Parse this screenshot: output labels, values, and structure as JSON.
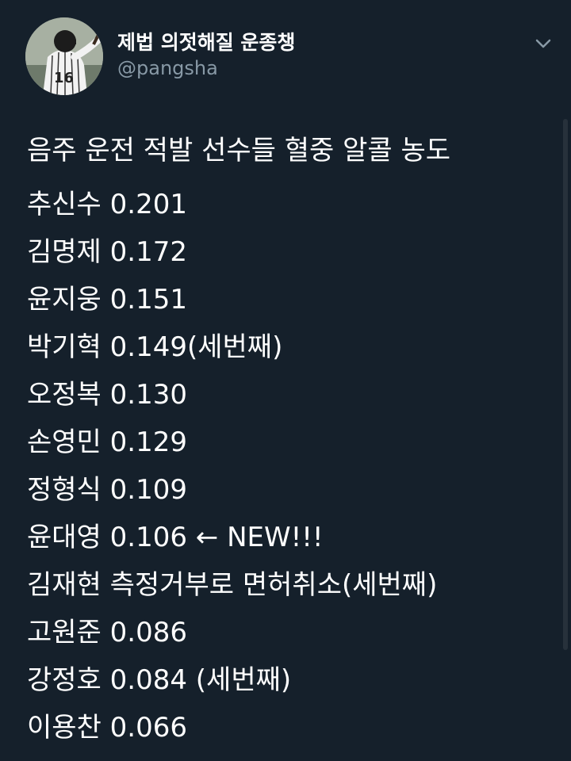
{
  "user": {
    "display_name": "제법 의젓해질 운종챙",
    "handle": "@pangsha",
    "avatar_jersey_number": "16"
  },
  "tweet": {
    "title": "음주 운전 적발 선수들 혈중 알콜 농도",
    "lines": [
      "추신수 0.201",
      "김명제 0.172",
      "윤지웅 0.151",
      "박기혁 0.149(세번째)",
      "오정복 0.130",
      "손영민 0.129",
      "정형식 0.109",
      "윤대영 0.106  ←  NEW!!!",
      "김재현 측정거부로 면허취소(세번째)",
      "고원준 0.086",
      "강정호 0.084 (세번째)",
      "이용찬 0.066"
    ]
  },
  "icons": {
    "menu": "chevron-down-icon"
  },
  "colors": {
    "background": "#15202b",
    "text": "#ffffff",
    "secondary_text": "#8899a6"
  }
}
